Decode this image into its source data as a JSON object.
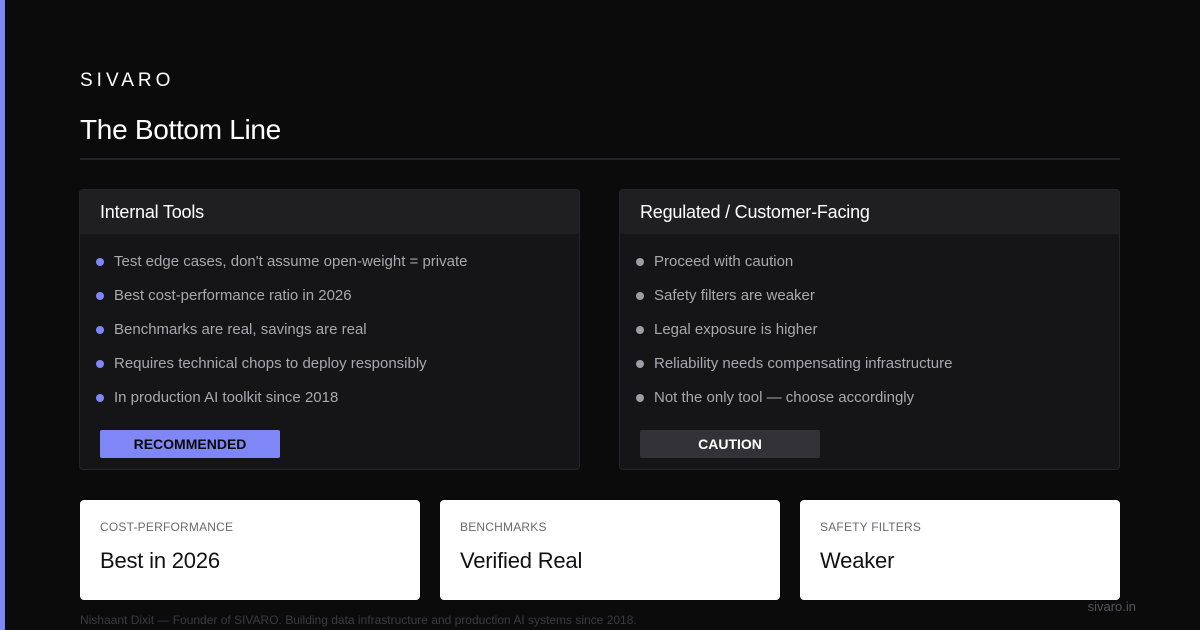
{
  "colors": {
    "accent": "#7f86f5",
    "background": "#0b0b0c",
    "card": "#ffffff"
  },
  "brand": "SIVARO",
  "title": "The Bottom Line",
  "panels": [
    {
      "heading": "Internal Tools",
      "items": [
        "Test edge cases, don't assume open-weight = private",
        "Best cost-performance ratio in 2026",
        "Benchmarks are real, savings are real",
        "Requires technical chops to deploy responsibly",
        "In production AI toolkit since 2018"
      ],
      "badge": "RECOMMENDED"
    },
    {
      "heading": "Regulated / Customer-Facing",
      "items": [
        "Proceed with caution",
        "Safety filters are weaker",
        "Legal exposure is higher",
        "Reliability needs compensating infrastructure",
        "Not the only tool — choose accordingly"
      ],
      "badge": "CAUTION"
    }
  ],
  "stats": [
    {
      "label": "COST-PERFORMANCE",
      "value": "Best in 2026"
    },
    {
      "label": "BENCHMARKS",
      "value": "Verified Real"
    },
    {
      "label": "SAFETY FILTERS",
      "value": "Weaker"
    }
  ],
  "footer": {
    "note": "Nishaant Dixit — Founder of SIVARO. Building data infrastructure and production AI systems since 2018.",
    "site": "sivaro.in"
  }
}
